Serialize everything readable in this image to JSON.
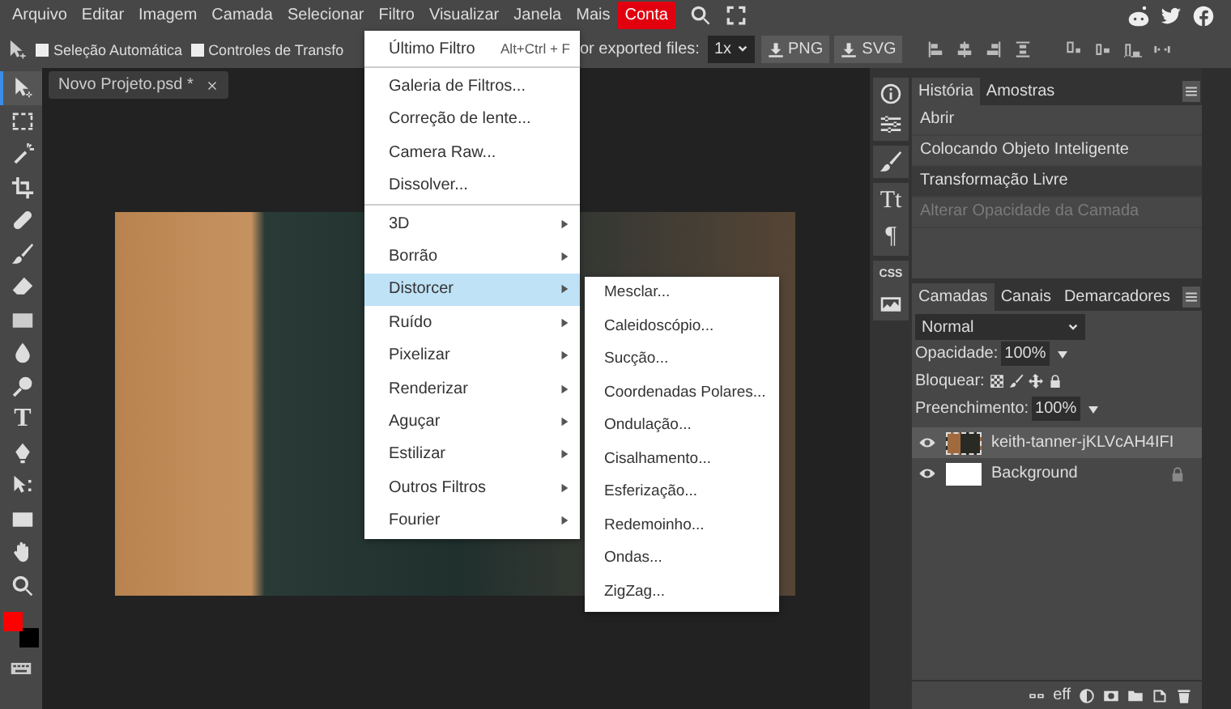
{
  "menubar": {
    "items": [
      {
        "label": "Arquivo",
        "highlighted": false
      },
      {
        "label": "Editar",
        "highlighted": false
      },
      {
        "label": "Imagem",
        "highlighted": false
      },
      {
        "label": "Camada",
        "highlighted": false
      },
      {
        "label": "Selecionar",
        "highlighted": false
      },
      {
        "label": "Filtro",
        "highlighted": false
      },
      {
        "label": "Visualizar",
        "highlighted": false
      },
      {
        "label": "Janela",
        "highlighted": false
      },
      {
        "label": "Mais",
        "highlighted": false
      },
      {
        "label": "Conta",
        "highlighted": true
      }
    ]
  },
  "toolbar": {
    "auto_select": {
      "label": "Seleção Automática",
      "checked": false
    },
    "transform_controls": {
      "label": "Controles de Transfo",
      "checked": false
    },
    "export_label": "or exported files:",
    "scale": "1x",
    "export_buttons": [
      "PNG",
      "SVG"
    ]
  },
  "tools": [
    {
      "kind": "move",
      "selected": true
    },
    {
      "kind": "marquee",
      "selected": false
    },
    {
      "kind": "wand",
      "selected": false
    },
    {
      "kind": "crop",
      "selected": false
    },
    {
      "kind": "heal",
      "selected": false
    },
    {
      "kind": "brush",
      "selected": false
    },
    {
      "kind": "eraser",
      "selected": false
    },
    {
      "kind": "gradient",
      "selected": false
    },
    {
      "kind": "drop",
      "selected": false
    },
    {
      "kind": "dodge",
      "selected": false
    },
    {
      "kind": "glyph",
      "glyph": "T",
      "selected": false
    },
    {
      "kind": "pen",
      "selected": false
    },
    {
      "kind": "path",
      "selected": false
    },
    {
      "kind": "shape",
      "selected": false
    },
    {
      "kind": "hand",
      "selected": false
    },
    {
      "kind": "zoom",
      "selected": false
    }
  ],
  "document": {
    "title": "Novo Projeto.psd *"
  },
  "filter_menu": {
    "groups": [
      [
        {
          "label": "Último Filtro",
          "shortcut": "Alt+Ctrl + F",
          "submenu": false,
          "highlighted": false
        }
      ],
      [
        {
          "label": "Galeria de Filtros...",
          "submenu": false,
          "highlighted": false
        },
        {
          "label": "Correção de lente...",
          "submenu": false,
          "highlighted": false
        },
        {
          "label": "Camera Raw...",
          "submenu": false,
          "highlighted": false
        },
        {
          "label": "Dissolver...",
          "submenu": false,
          "highlighted": false
        }
      ],
      [
        {
          "label": "3D",
          "submenu": true,
          "highlighted": false
        },
        {
          "label": "Borrão",
          "submenu": true,
          "highlighted": false
        },
        {
          "label": "Distorcer",
          "submenu": true,
          "highlighted": true
        },
        {
          "label": "Ruído",
          "submenu": true,
          "highlighted": false
        },
        {
          "label": "Pixelizar",
          "submenu": true,
          "highlighted": false
        },
        {
          "label": "Renderizar",
          "submenu": true,
          "highlighted": false
        },
        {
          "label": "Aguçar",
          "submenu": true,
          "highlighted": false
        },
        {
          "label": "Estilizar",
          "submenu": true,
          "highlighted": false
        },
        {
          "label": "Outros Filtros",
          "submenu": true,
          "highlighted": false
        },
        {
          "label": "Fourier",
          "submenu": true,
          "highlighted": false
        }
      ]
    ],
    "submenu": [
      "Mesclar...",
      "Caleidoscópio...",
      "Sucção...",
      "Coordenadas Polares...",
      "Ondulação...",
      "Cisalhamento...",
      "Esferização...",
      "Redemoinho...",
      "Ondas...",
      "ZigZag..."
    ]
  },
  "side_icons": [
    [
      {
        "kind": "info"
      },
      {
        "kind": "sliders"
      }
    ],
    [
      {
        "kind": "brush"
      }
    ],
    [
      {
        "kind": "glyph",
        "glyph": "Tt"
      },
      {
        "kind": "glyph",
        "glyph": "¶"
      }
    ],
    [
      {
        "kind": "glyph",
        "glyph": "CSS"
      },
      {
        "kind": "image"
      }
    ]
  ],
  "history": {
    "tabs": [
      {
        "label": "História",
        "selected": true
      },
      {
        "label": "Amostras",
        "selected": false
      }
    ],
    "items": [
      {
        "label": "Abrir",
        "selected": false,
        "disabled": false
      },
      {
        "label": "Colocando Objeto Inteligente",
        "selected": false,
        "disabled": false
      },
      {
        "label": "Transformação Livre",
        "selected": true,
        "disabled": false
      },
      {
        "label": "Alterar Opacidade da Camada",
        "selected": false,
        "disabled": true
      }
    ]
  },
  "layers": {
    "tabs": [
      {
        "label": "Camadas",
        "selected": true
      },
      {
        "label": "Canais",
        "selected": false
      },
      {
        "label": "Demarcadores",
        "selected": false
      }
    ],
    "blend_mode": "Normal",
    "opacity": {
      "label": "Opacidade:",
      "value": "100%"
    },
    "lock_label": "Bloquear:",
    "fill": {
      "label": "Preenchimento:",
      "value": "100%"
    },
    "items": [
      {
        "name": "keith-tanner-jKLVcAH4IFI",
        "kind": "photo",
        "selected": true,
        "visible": true,
        "locked": false
      },
      {
        "name": "Background",
        "kind": "white",
        "selected": false,
        "visible": true,
        "locked": true
      }
    ],
    "footer_icons": [
      {
        "kind": "link"
      },
      {
        "kind": "glyph",
        "glyph": "eff"
      },
      {
        "kind": "adjust"
      },
      {
        "kind": "mask"
      },
      {
        "kind": "folder"
      },
      {
        "kind": "page"
      },
      {
        "kind": "trash"
      }
    ]
  }
}
